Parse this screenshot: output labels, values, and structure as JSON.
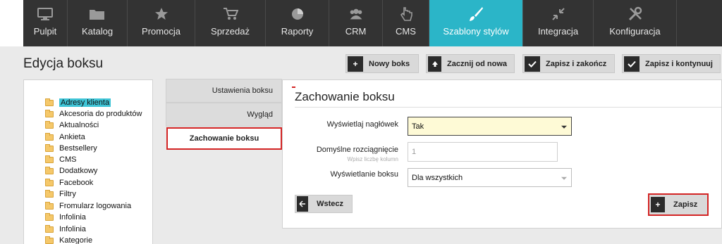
{
  "nav": {
    "items": [
      {
        "label": "Pulpit",
        "icon": "monitor-icon"
      },
      {
        "label": "Katalog",
        "icon": "folder-icon"
      },
      {
        "label": "Promocja",
        "icon": "star-icon"
      },
      {
        "label": "Sprzedaż",
        "icon": "cart-icon"
      },
      {
        "label": "Raporty",
        "icon": "pie-chart-icon"
      },
      {
        "label": "CRM",
        "icon": "users-icon"
      },
      {
        "label": "CMS",
        "icon": "hand-pointer-icon"
      },
      {
        "label": "Szablony stylów",
        "icon": "brush-icon"
      },
      {
        "label": "Integracja",
        "icon": "compress-arrows-icon"
      },
      {
        "label": "Konfiguracja",
        "icon": "tools-icon"
      }
    ],
    "active_index": 7,
    "active_color": "#2bb5c8"
  },
  "page": {
    "title": "Edycja boksu"
  },
  "toolbar": {
    "new_box": "Nowy boks",
    "start_over": "Zacznij od nowa",
    "save_finish": "Zapisz i zakończ",
    "save_continue": "Zapisz i kontynuuj"
  },
  "tree": {
    "items": [
      {
        "label": "Adresy klienta",
        "selected": true
      },
      {
        "label": "Akcesoria do produktów"
      },
      {
        "label": "Aktualności"
      },
      {
        "label": "Ankieta"
      },
      {
        "label": "Bestsellery"
      },
      {
        "label": "CMS"
      },
      {
        "label": "Dodatkowy"
      },
      {
        "label": "Facebook"
      },
      {
        "label": "Filtry"
      },
      {
        "label": "Fromularz logowania"
      },
      {
        "label": "Infolinia"
      },
      {
        "label": "Infolinia"
      },
      {
        "label": "Kategorie"
      }
    ]
  },
  "tabs": {
    "settings": "Ustawienia boksu",
    "look": "Wygląd",
    "behavior": "Zachowanie boksu"
  },
  "form": {
    "title": "Zachowanie boksu",
    "show_header": {
      "label": "Wyświetlaj nagłówek",
      "value": "Tak"
    },
    "default_stretch": {
      "label": "Domyślne rozciągnięcie",
      "hint": "Wpisz liczbę kolumn",
      "value": "1"
    },
    "display": {
      "label": "Wyświetlanie boksu",
      "value": "Dla wszystkich"
    },
    "back_button": "Wstecz",
    "save_button": "Zapisz"
  },
  "colors": {
    "nav_bg": "#333333",
    "highlight_outline": "#d32424",
    "selected_tree": "#3fc4d6"
  }
}
